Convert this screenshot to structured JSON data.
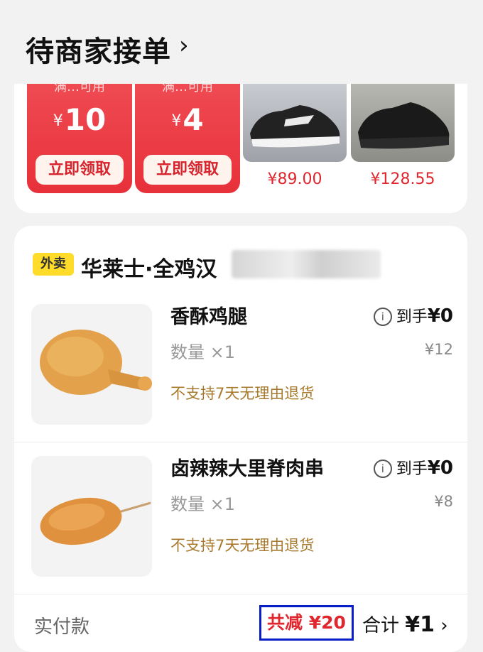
{
  "header": {
    "title": "待商家接单",
    "chevron": "›"
  },
  "promo": {
    "coupons": [
      {
        "top_text": "满…可用",
        "yen": "¥",
        "amount": "10",
        "button": "立即领取"
      },
      {
        "top_text": "满…可用",
        "yen": "¥",
        "amount": "4",
        "button": "立即领取"
      }
    ],
    "products": [
      {
        "image": "white-sneaker-image",
        "price": "¥89.00"
      },
      {
        "image": "black-sneaker-image",
        "price": "¥128.55"
      }
    ]
  },
  "order": {
    "tag": "外卖",
    "shop_name": "华莱士·全鸡汉",
    "items": [
      {
        "name": "香酥鸡腿",
        "qty": "数量 ×1",
        "policy": "不支持7天无理由退货",
        "info_icon": "i",
        "net_label": "到手",
        "net_value": "¥0",
        "orig_price": "¥12"
      },
      {
        "name": "卤辣辣大里脊肉串",
        "qty": "数量 ×1",
        "policy": "不支持7天无理由退货",
        "info_icon": "i",
        "net_label": "到手",
        "net_value": "¥0",
        "orig_price": "¥8"
      }
    ],
    "footer": {
      "label": "实付款",
      "reduce": "共减 ¥20",
      "total_label": "合计",
      "total_value": "¥1",
      "chevron": "›"
    }
  },
  "colors": {
    "accent_red": "#e0262e",
    "coupon_red": "#e8313a",
    "tag_yellow": "#ffdc2a",
    "policy_brown": "#a87a2d",
    "highlight_box": "#0a1ec8"
  }
}
